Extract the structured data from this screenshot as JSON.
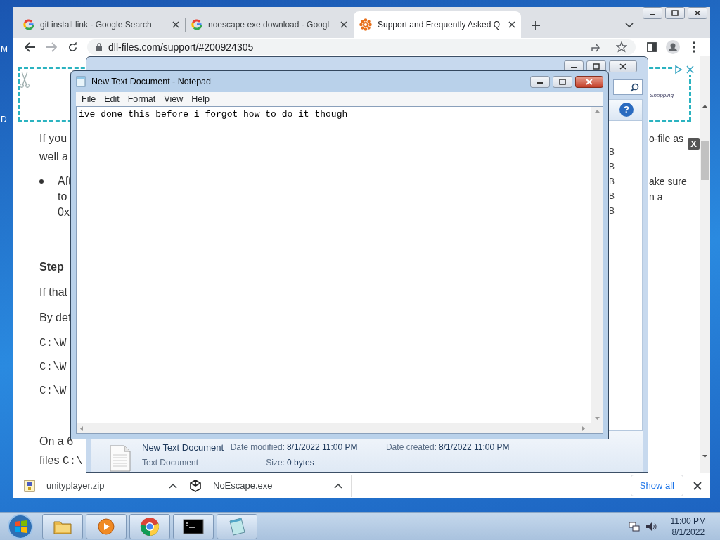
{
  "desktop": {
    "icon_labels": [
      "M",
      "D"
    ]
  },
  "browser": {
    "tabs": [
      {
        "title": "git install link - Google Search",
        "kind": "google",
        "selected": false
      },
      {
        "title": "noescape exe download - Googl",
        "kind": "google",
        "selected": false
      },
      {
        "title": "Support and Frequently Asked Q",
        "kind": "site",
        "selected": true
      }
    ],
    "address": "dll-files.com/support/#200924305",
    "ad": {
      "text": "Shopping",
      "close_label": "X"
    },
    "page_left": [
      {
        "kind": "para",
        "lines": [
          "If you",
          "well a"
        ]
      },
      {
        "kind": "bullet",
        "lines": [
          "Aft",
          "to",
          "0x"
        ]
      },
      {
        "kind": "heading",
        "lines": [
          "Step"
        ]
      },
      {
        "kind": "para",
        "lines": [
          "If that"
        ]
      },
      {
        "kind": "para",
        "lines": [
          "By def"
        ]
      },
      {
        "kind": "code",
        "lines": [
          "C:\\W"
        ]
      },
      {
        "kind": "code",
        "lines": [
          "C:\\W"
        ]
      },
      {
        "kind": "code",
        "lines": [
          "C:\\W"
        ]
      },
      {
        "kind": "para",
        "lines": [
          "On a 6"
        ]
      },
      {
        "kind": "mixed",
        "text": "files",
        "code": "C:\\"
      }
    ],
    "page_right": [
      {
        "kind": "para",
        "lines": [
          "o-file as"
        ]
      },
      {
        "kind": "bullet",
        "lines": [
          "ake sure",
          "n a"
        ]
      }
    ],
    "downloads": [
      {
        "name": "unityplayer.zip",
        "kind": "zip"
      },
      {
        "name": "NoEscape.exe",
        "kind": "exe"
      }
    ],
    "show_all": "Show all"
  },
  "explorer": {
    "help": "?",
    "size_column": [
      "B",
      "B",
      "B",
      "B",
      "B"
    ],
    "details": {
      "name": "New Text Document",
      "date_modified_label": "Date modified:",
      "date_modified": "8/1/2022 11:00 PM",
      "date_created_label": "Date created:",
      "date_created": "8/1/2022 11:00 PM",
      "type": "Text Document",
      "size_label": "Size:",
      "size": "0 bytes"
    }
  },
  "notepad": {
    "title": "New Text Document - Notepad",
    "menu": [
      "File",
      "Edit",
      "Format",
      "View",
      "Help"
    ],
    "text": "ive done this before i forgot how to do it though"
  },
  "taskbar": {
    "apps": [
      {
        "kind": "explorer"
      },
      {
        "kind": "media"
      },
      {
        "kind": "chrome"
      },
      {
        "kind": "cmd"
      },
      {
        "kind": "notepad"
      }
    ],
    "time": "11:00 PM",
    "date": "8/1/2022"
  }
}
